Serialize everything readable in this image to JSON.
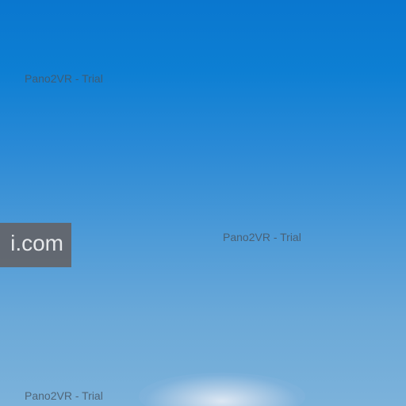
{
  "scene": {
    "description_colors": {
      "sky_top": "#0a77cf",
      "sky_bottom": "#7cb2da",
      "watermark_text": "#485462",
      "url_tag_background": "#646468"
    }
  },
  "watermarks": [
    "Pano2VR - Trial",
    "Pano2VR - Trial",
    "Pano2VR - Trial"
  ],
  "url_tag": {
    "text": "i.com"
  }
}
